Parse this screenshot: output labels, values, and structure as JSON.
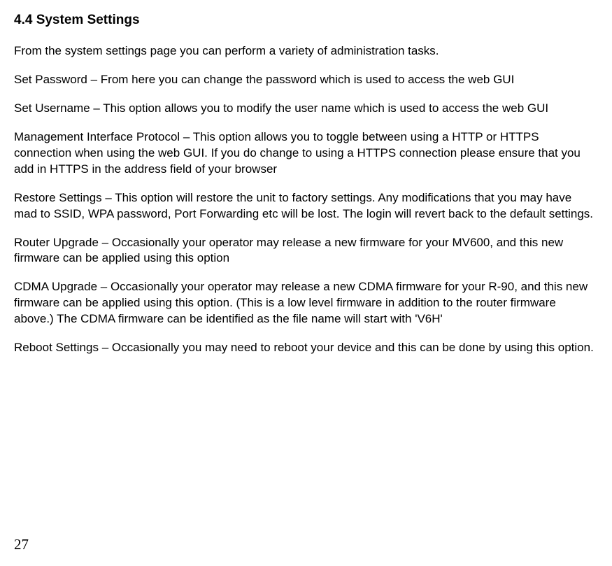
{
  "heading": "4.4   System Settings",
  "paragraphs": {
    "intro": "From the system settings page you can perform a variety of administration tasks.",
    "setPassword": "Set Password – From here you can change the password which is used to access the web GUI",
    "setUsername": "Set Username – This option allows you to modify the user name which is used to access the web GUI",
    "managementInterface": "Management Interface Protocol – This option allows you to toggle between using a HTTP or HTTPS connection when using the web GUI.  If you do change to using a HTTPS connection please ensure that you add in HTTPS in the address field of your browser",
    "restoreSettings": "Restore Settings – This option will restore the unit to factory settings.  Any modifications that you may have mad to SSID, WPA password, Port Forwarding etc will be lost.  The login will revert back to the default settings.",
    "routerUpgrade": "Router Upgrade – Occasionally your operator may release a new firmware for your MV600, and this new firmware can be applied using this option",
    "cdmaUpgrade": "CDMA Upgrade – Occasionally your operator may release a new CDMA firmware for your R-90, and this new firmware can be applied using this option. (This is a low level firmware in addition to the router firmware above.) The CDMA firmware can be identified as the file name will start with 'V6H'",
    "rebootSettings": "Reboot Settings – Occasionally you may need to reboot your device and this can be done by using this option."
  },
  "pageNumber": "27"
}
